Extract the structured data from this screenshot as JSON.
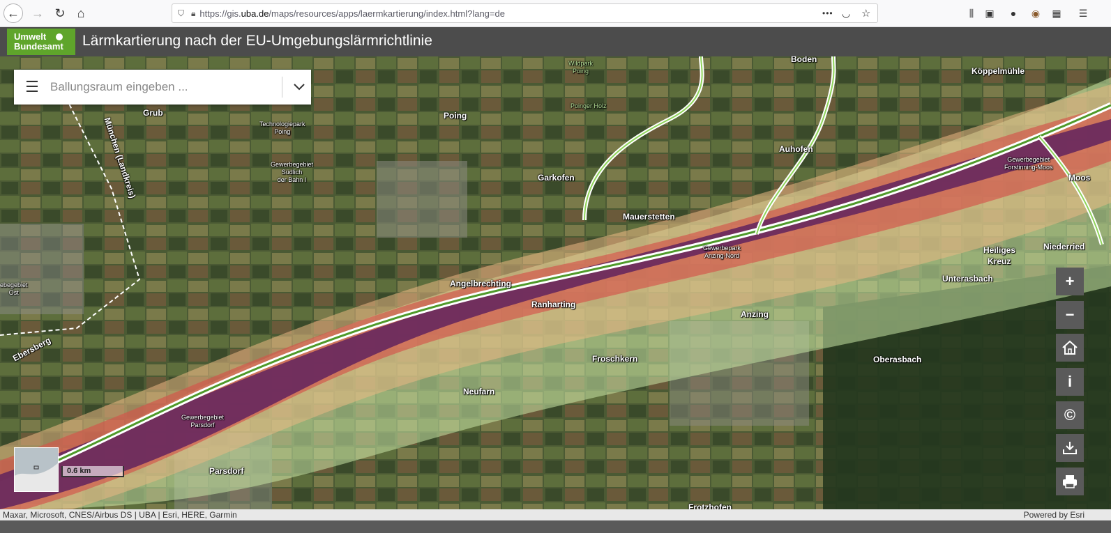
{
  "browser": {
    "url_prefix": "https://gis.",
    "url_domain": "uba.de",
    "url_path": "/maps/resources/apps/laermkartierung/index.html?lang=de",
    "more_label": "•••"
  },
  "header": {
    "logo_line1": "Umwelt",
    "logo_line2": "Bundesamt",
    "title": "Lärmkartierung nach der EU-Umgebungslärmrichtlinie"
  },
  "search": {
    "placeholder": "Ballungsraum eingeben ..."
  },
  "places": [
    {
      "name": "Grub"
    },
    {
      "name": "Poing"
    },
    {
      "name": "Boden"
    },
    {
      "name": "Köppelmühle"
    },
    {
      "name": "Auhofen"
    },
    {
      "name": "Garkofen"
    },
    {
      "name": "Mauerstetten"
    },
    {
      "name": "Moos"
    },
    {
      "name": "Niederried"
    },
    {
      "name": "Heiliges"
    },
    {
      "name": "Kreuz"
    },
    {
      "name": "Unterasbach"
    },
    {
      "name": "Angelbrechting"
    },
    {
      "name": "Ranharting"
    },
    {
      "name": "Anzing"
    },
    {
      "name": "Froschkern"
    },
    {
      "name": "Oberasbach"
    },
    {
      "name": "Neufarn"
    },
    {
      "name": "Parsdorf"
    },
    {
      "name": "Frotzhofen"
    },
    {
      "name": "Ebersberg"
    },
    {
      "name": "München (Landkreis)"
    }
  ],
  "small_labels": [
    {
      "line1": "Technologiepark",
      "line2": "Poing"
    },
    {
      "line1": "Gewerbegebiet",
      "line2": "Südlich",
      "line3": "der Bahn I"
    },
    {
      "line1": "Wildpark",
      "line2": "Poing"
    },
    {
      "line1": "Poinger Holz"
    },
    {
      "line1": "Gewerbegebiet",
      "line2": "Forstinning-Moos"
    },
    {
      "line1": "Gewerbepark",
      "line2": "Anzing-Nord"
    },
    {
      "line1": "Gewerbegebiet",
      "line2": "Parsdorf"
    },
    {
      "line1": "ebegebiet",
      "line2": "Ost"
    }
  ],
  "scale": "0.6 km",
  "attribution": {
    "left": "Maxar, Microsoft, CNES/Airbus DS | UBA | Esri, HERE, Garmin",
    "right": "Powered by Esri"
  },
  "tools": {
    "zoom_in": "+",
    "zoom_out": "−",
    "info": "i",
    "copyright": "©"
  }
}
